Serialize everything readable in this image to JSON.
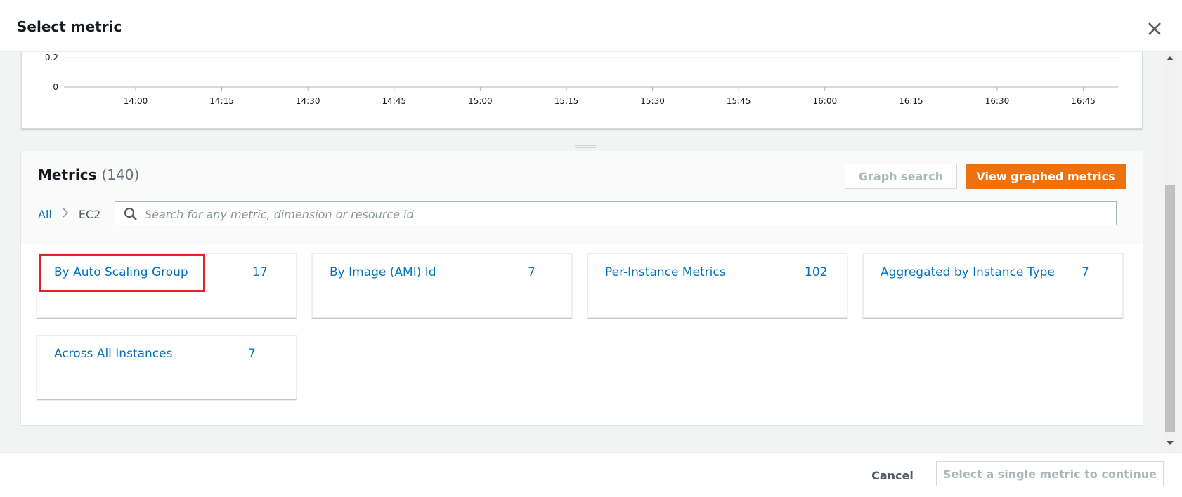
{
  "modal": {
    "title": "Select metric",
    "close_icon": "close-icon"
  },
  "graph": {
    "y_ticks": [
      "0.2",
      "0"
    ],
    "x_ticks": [
      "14:00",
      "14:15",
      "14:30",
      "14:45",
      "15:00",
      "15:15",
      "15:30",
      "15:45",
      "16:00",
      "16:15",
      "16:30",
      "16:45"
    ]
  },
  "metrics": {
    "heading": "Metrics",
    "count": "(140)",
    "graph_search_label": "Graph search",
    "view_graphed_label": "View graphed metrics",
    "breadcrumb": {
      "all": "All",
      "current": "EC2"
    },
    "search": {
      "placeholder": "Search for any metric, dimension or resource id",
      "value": ""
    },
    "cards": [
      {
        "label": "By Auto Scaling Group",
        "count": "17",
        "highlighted": true
      },
      {
        "label": "By Image (AMI) Id",
        "count": "7"
      },
      {
        "label": "Per-Instance Metrics",
        "count": "102"
      },
      {
        "label": "Aggregated by Instance Type",
        "count": "7"
      },
      {
        "label": "Across All Instances",
        "count": "7"
      }
    ]
  },
  "footer": {
    "cancel_label": "Cancel",
    "continue_label": "Select a single metric to continue"
  },
  "colors": {
    "primary": "#ec7211",
    "link": "#0073bb",
    "highlight": "#e32227"
  }
}
